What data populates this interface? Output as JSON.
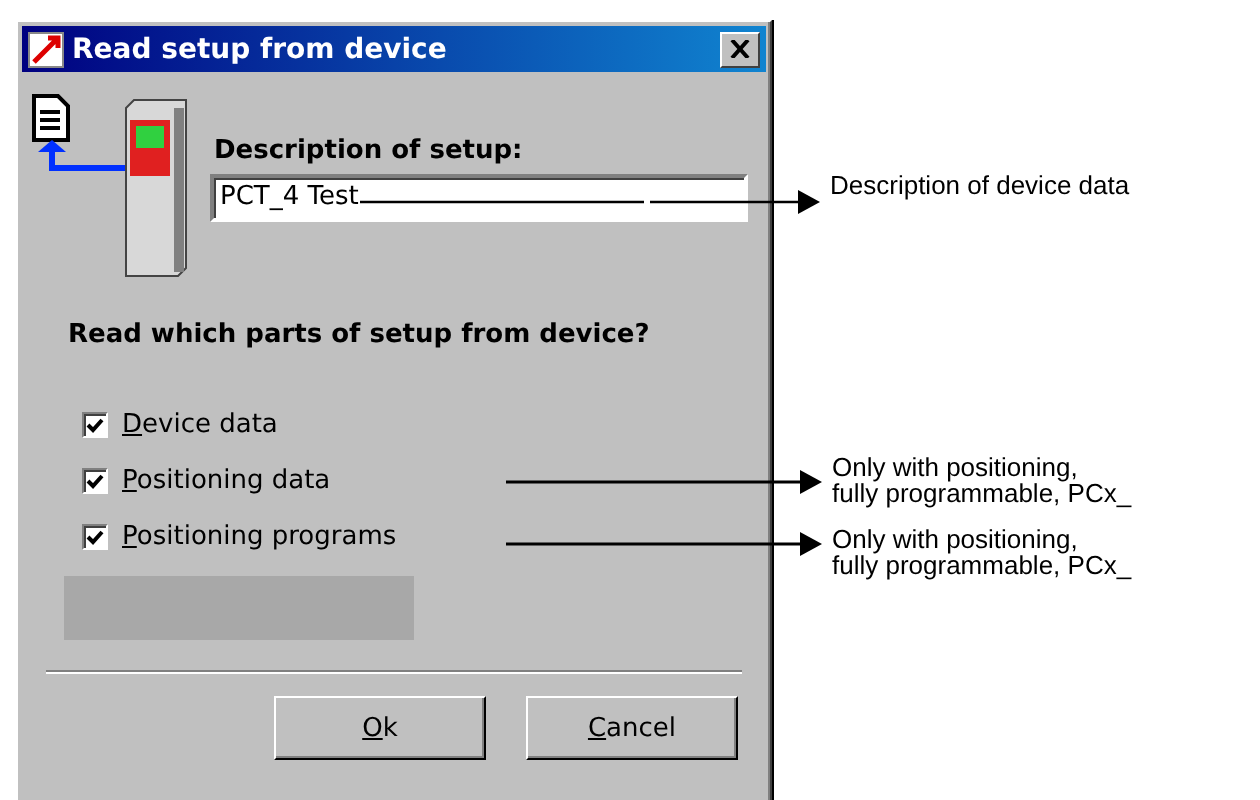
{
  "window": {
    "title": "Read setup from device"
  },
  "description": {
    "label": "Description of setup:",
    "value": "PCT_4 Test"
  },
  "question": "Read which parts of setup from device?",
  "options": [
    {
      "label": "Device data",
      "checked": true
    },
    {
      "label": "Positioning data",
      "checked": true
    },
    {
      "label": "Positioning programs",
      "checked": true
    }
  ],
  "buttons": [
    "Ok",
    "Cancel"
  ],
  "annotations": [
    {
      "lines": [
        "Description of device data"
      ]
    },
    {
      "lines": [
        "Only with positioning,",
        "fully programmable, PCx_"
      ]
    },
    {
      "lines": [
        "Only with positioning,",
        "fully programmable, PCx_"
      ]
    }
  ]
}
